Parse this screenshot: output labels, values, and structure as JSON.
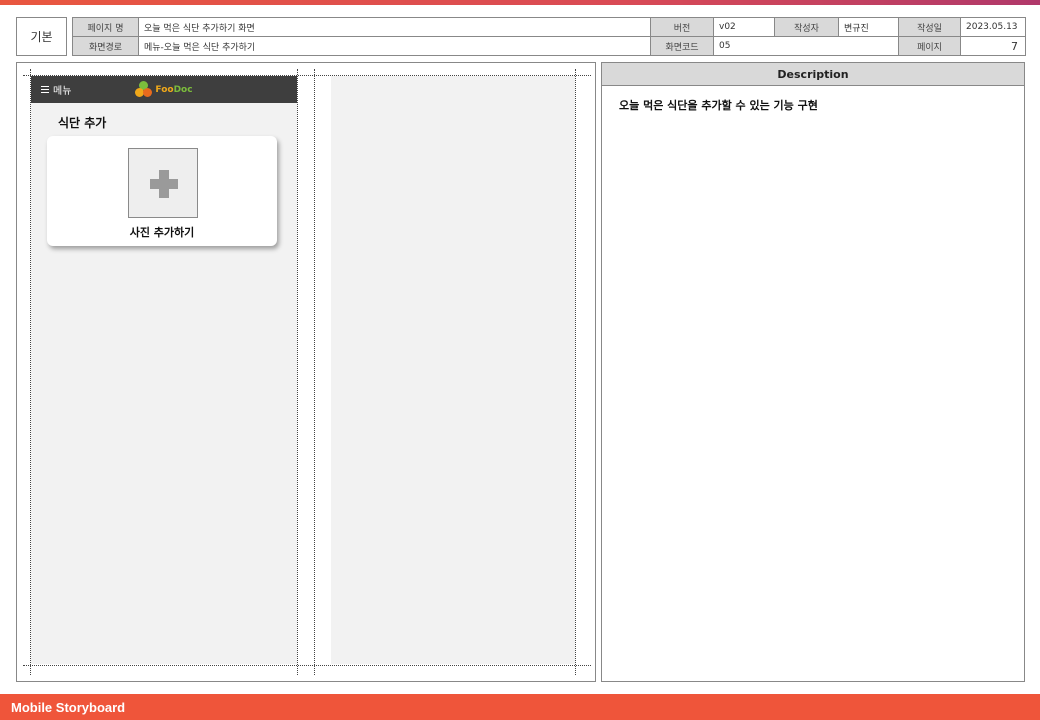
{
  "header": {
    "kind": "기본",
    "page_name_label": "페이지 명",
    "page_name": "오늘 먹은 식단 추가하기 화면",
    "version_label": "버전",
    "version": "v02",
    "author_label": "작성자",
    "author": "변규진",
    "date_label": "작성일",
    "date": "2023.05.13",
    "path_label": "화면경로",
    "path": "메뉴-오늘 먹은 식단 추가하기",
    "code_label": "화면코드",
    "code": "05",
    "page_label": "페이지",
    "page": "7"
  },
  "app": {
    "menu_label": "메뉴",
    "brand_part1": "Foo",
    "brand_part2": "Doc",
    "section_title": "식단 추가",
    "add_photo_label": "사진 추가하기"
  },
  "description": {
    "title": "Description",
    "text": "오늘 먹은 식단을 추가할 수 있는 기능 구현"
  },
  "footer": {
    "label": "Mobile Storyboard"
  },
  "colors": {
    "accent": "#ef553a",
    "appbar": "#3e3e3e",
    "label_bg": "#d9d9d9"
  }
}
